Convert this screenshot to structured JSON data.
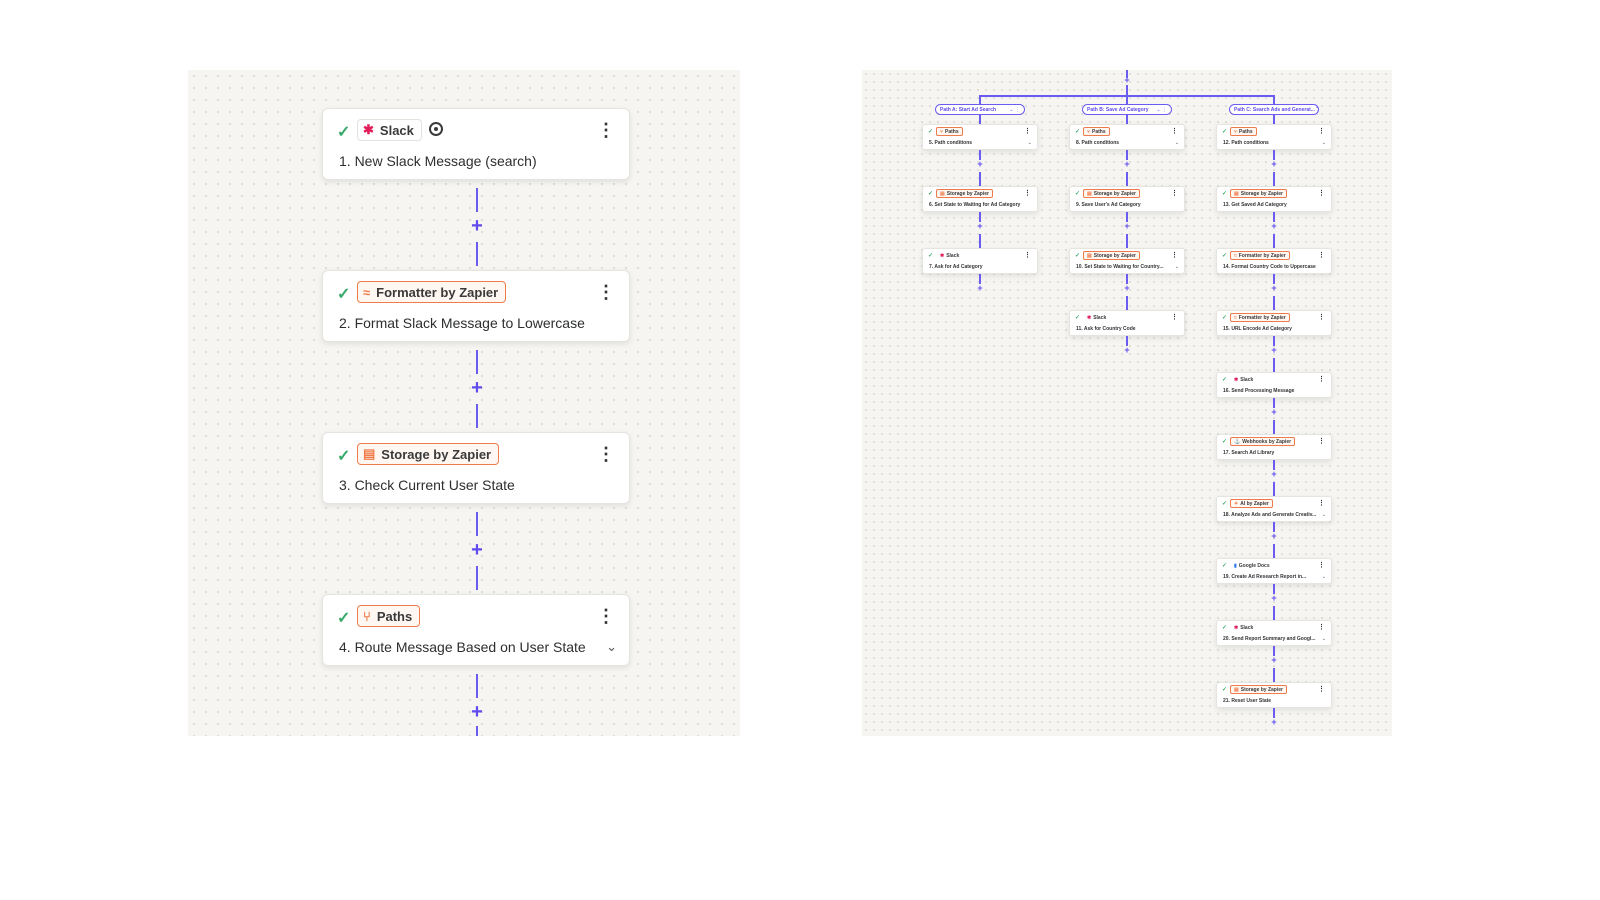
{
  "left_steps": [
    {
      "app": "Slack",
      "title": "1. New Slack Message (search)"
    },
    {
      "app": "Formatter by Zapier",
      "title": "2. Format Slack Message to Lowercase"
    },
    {
      "app": "Storage by Zapier",
      "title": "3. Check Current User State"
    },
    {
      "app": "Paths",
      "title": "4. Route Message Based on User State"
    }
  ],
  "right_paths": [
    {
      "label": "Path A: Start Ad Search",
      "steps": [
        {
          "app": "Paths",
          "title": "5. Path conditions"
        },
        {
          "app": "Storage by Zapier",
          "title": "6. Set State to Waiting for Ad Category"
        },
        {
          "app": "Slack",
          "title": "7. Ask for Ad Category"
        }
      ]
    },
    {
      "label": "Path B: Save Ad Category",
      "steps": [
        {
          "app": "Paths",
          "title": "8. Path conditions"
        },
        {
          "app": "Storage by Zapier",
          "title": "9. Save User's Ad Category"
        },
        {
          "app": "Storage by Zapier",
          "title": "10. Set State to Waiting for Country..."
        },
        {
          "app": "Slack",
          "title": "11. Ask for Country Code"
        }
      ]
    },
    {
      "label": "Path C: Search Ads and Generat...",
      "steps": [
        {
          "app": "Paths",
          "title": "12. Path conditions"
        },
        {
          "app": "Storage by Zapier",
          "title": "13. Get Saved Ad Category"
        },
        {
          "app": "Formatter by Zapier",
          "title": "14. Format Country Code to Uppercase"
        },
        {
          "app": "Formatter by Zapier",
          "title": "15. URL Encode Ad Category"
        },
        {
          "app": "Slack",
          "title": "16. Send Processing Message"
        },
        {
          "app": "Webhooks by Zapier",
          "title": "17. Search Ad Library"
        },
        {
          "app": "AI by Zapier",
          "title": "18. Analyze Ads and Generate Creativ..."
        },
        {
          "app": "Google Docs",
          "title": "19. Create Ad Research Report in..."
        },
        {
          "app": "Slack",
          "title": "20. Send Report Summary and Googl..."
        },
        {
          "app": "Storage by Zapier",
          "title": "21. Reset User State"
        }
      ]
    }
  ],
  "glyphs": {
    "check": "✓",
    "kebab": "⋮",
    "chevron": "⌄",
    "plus": "+",
    "pill_controls": "⌄ ⋮"
  },
  "colors": {
    "accent": "#6a5cf0",
    "app_border": "#f07b4a",
    "check": "#39a96b",
    "canvas": "#f6f5f2"
  }
}
